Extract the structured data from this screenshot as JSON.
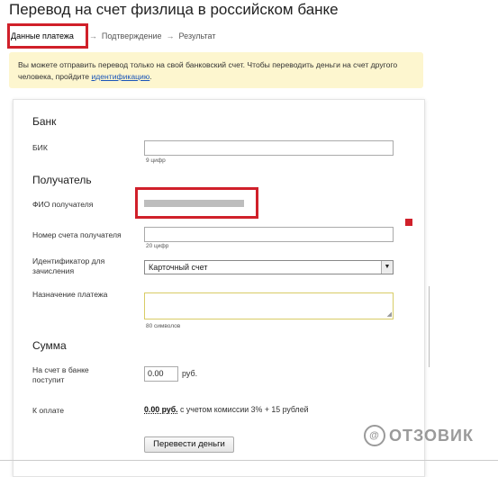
{
  "page": {
    "title": "Перевод на счет физлица в российском банке"
  },
  "steps": {
    "active": "Данные платежа",
    "items": [
      "Подтверждение",
      "Результат"
    ],
    "separator": "→"
  },
  "notice": {
    "text": "Вы можете отправить перевод только на свой банковский счет. Чтобы переводить деньги на счет другого человека, пройдите",
    "link": "идентификацию",
    "end": "."
  },
  "bank": {
    "title": "Банк",
    "bik_label": "БИК",
    "bik_hint": "9 цифр",
    "bik_value": ""
  },
  "recipient": {
    "title": "Получатель",
    "name_label": "ФИО получателя",
    "account_label": "Номер счета получателя",
    "account_hint": "20 цифр",
    "account_value": "",
    "identifier_label": "Идентификатор для зачисления",
    "identifier_value": "Карточный счет",
    "identifier_arrow": "▼",
    "purpose_label": "Назначение платежа",
    "purpose_hint": "80 символов",
    "purpose_grip": "◢"
  },
  "sum": {
    "title": "Сумма",
    "receive_label": "На счет в банке поступит",
    "receive_value": "0.00",
    "unit": "руб.",
    "pay_label": "К оплате",
    "pay_amount": "0.00 руб.",
    "pay_note": "с учетом комиссии 3% + 15 рублей"
  },
  "submit": {
    "label": "Перевести деньги"
  },
  "watermark": {
    "text": "ОТЗОВИК",
    "mark": "@"
  },
  "colors": {
    "highlight": "#d0202a",
    "notice_bg": "#fdf6cf",
    "link": "#1a55b8"
  }
}
